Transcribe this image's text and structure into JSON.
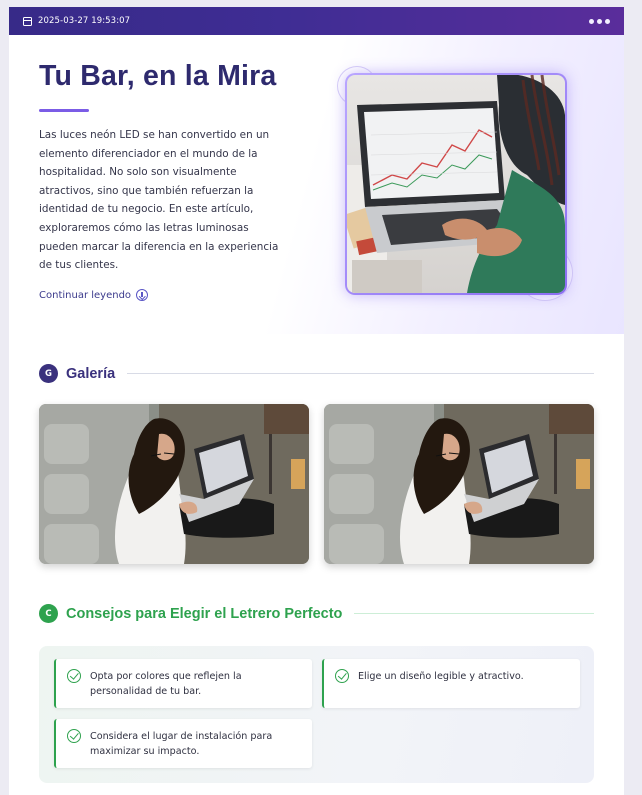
{
  "topbar": {
    "date": "2025-03-27 19:53:07",
    "calendar_icon": "calendar-icon",
    "menu_icon": "more-dots-icon"
  },
  "hero": {
    "title": "Tu Bar, en la Mira",
    "body": "Las luces neón LED se han convertido en un elemento diferenciador en el mundo de la hospitalidad. No solo son visualmente atractivos, sino que también refuerzan la identidad de tu negocio. En este artículo, exploraremos cómo las letras luminosas pueden marcar la diferencia en la experiencia de tus clientes.",
    "link": "Continuar leyendo",
    "link_icon": "arrow-down-circle-icon"
  },
  "gallery": {
    "badge": "G",
    "title": "Galería",
    "accent": "#3a317d"
  },
  "tips": {
    "badge": "C",
    "title": "Consejos para Elegir el Letrero Perfecto",
    "accent": "#2ea24e",
    "items": [
      "Opta por colores que reflejen la personalidad de tu bar.",
      "Elige un diseño legible y atractivo.",
      "Considera el lugar de instalación para maximizar su impacto."
    ],
    "item_icon": "check-circle-icon"
  }
}
